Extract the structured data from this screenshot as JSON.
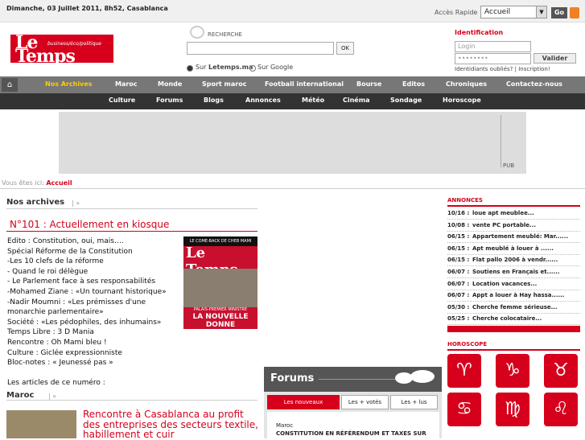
{
  "topbar": {
    "date": "Dimanche, 03 Juillet 2011, 8h52, Casablanca",
    "quick_label": "Accès Rapide",
    "quick_value": "Accueil",
    "go_label": "Go"
  },
  "logo": {
    "line1": "Le",
    "line2": "Temps",
    "tagline": "business/éco/politique"
  },
  "search": {
    "label": "RECHERCHE",
    "ok_label": "OK",
    "option1_prefix": "Sur ",
    "option1_site": "Letemps.ma",
    "option2_prefix": "Sur ",
    "option2_site": "Google"
  },
  "login": {
    "title": "Identification",
    "login_placeholder": "Login",
    "password_value": "••••••••",
    "submit_label": "Valider",
    "links": "Identidiants oubliés? | Inscription!"
  },
  "nav_main": [
    "Nos Archives",
    "Maroc",
    "Monde",
    "Sport maroc",
    "Football international",
    "Bourse",
    "Editos",
    "Chroniques",
    "Contactez-nous"
  ],
  "nav_sub": [
    "Culture",
    "Forums",
    "Blogs",
    "Annonces",
    "Météo",
    "Cinéma",
    "Sondage",
    "Horoscope"
  ],
  "ad": {
    "label": "PUB"
  },
  "breadcrumb": {
    "prefix": "Vous êtes ici: ",
    "current": "Accueil"
  },
  "archives": {
    "heading": "Nos archives",
    "arrow": "|  »",
    "issue_title": "N°101 : Actuellement en kiosque",
    "lines": [
      "Edito : Constitution, oui, mais….",
      "Spécial Réforme de la Constitution",
      "-Les 10 clefs de la réforme",
      "- Quand le roi délègue",
      "- Le Parlement face à ses responsabilités",
      "-Mohamed Ziane : «Un tournant historique»",
      "-Nadir Moumni  : «Les prémisses d'une monarchie parlementaire»",
      "Société : «Les pédophiles, des inhumains»",
      "Temps Libre : 3 D Mania",
      "Rencontre : Oh Mami bleu !",
      "Culture : Giclée expressionniste",
      "Bloc-notes : « Jeunessé pas »",
      "",
      "Les articles de ce numéro :"
    ],
    "cover": {
      "banner": "LE COME-BACK DE CHEB MAMI",
      "title": "Le Temps",
      "small": "PALAIS-PREMIER MINISTRE",
      "headline": "LA NOUVELLE DONNE"
    }
  },
  "maroc": {
    "heading": "Maroc",
    "arrow": "|  »",
    "article_title": "Rencontre à Casablanca au profit des entreprises des secteurs textile, habillement et cuir"
  },
  "forums": {
    "title": "Forums",
    "tabs": [
      "Les nouveaux",
      "Les + votés",
      "Les + lus"
    ],
    "category": "Maroc",
    "post": "CONSTITUTION EN RÉFÉRENDUM ET TAXES SUR"
  },
  "annonces": {
    "heading": "ANNONCES",
    "items": [
      {
        "date": "10/16 :",
        "text": "loue apt meublee..."
      },
      {
        "date": "10/08 :",
        "text": "vente PC portable..."
      },
      {
        "date": "06/15 :",
        "text": "Appartement meublé: Mar......"
      },
      {
        "date": "06/15 :",
        "text": "Apt meublé à louer à ......"
      },
      {
        "date": "06/15 :",
        "text": "Flat pallo 2006 à vendr......"
      },
      {
        "date": "06/07 :",
        "text": "Soutiens en Français et......"
      },
      {
        "date": "06/07 :",
        "text": "Location vacances..."
      },
      {
        "date": "06/07 :",
        "text": "Appt a louer à Hay hassa......"
      },
      {
        "date": "05/30 :",
        "text": "Cherche femme sérieuse..."
      },
      {
        "date": "05/25 :",
        "text": "Cherche colocataire..."
      }
    ]
  },
  "horoscope": {
    "heading": "HOROSCOPE",
    "signs": [
      "aries-icon",
      "capricorn-icon",
      "taurus-icon",
      "cancer-icon",
      "virgo-icon",
      "leo-icon"
    ],
    "glyphs": [
      "♈",
      "♑",
      "♉",
      "♋",
      "♍",
      "♌"
    ]
  },
  "colors": {
    "brand": "#d6001c",
    "nav_main": "#777777",
    "nav_sub": "#333333",
    "highlight": "#ffcc00"
  }
}
